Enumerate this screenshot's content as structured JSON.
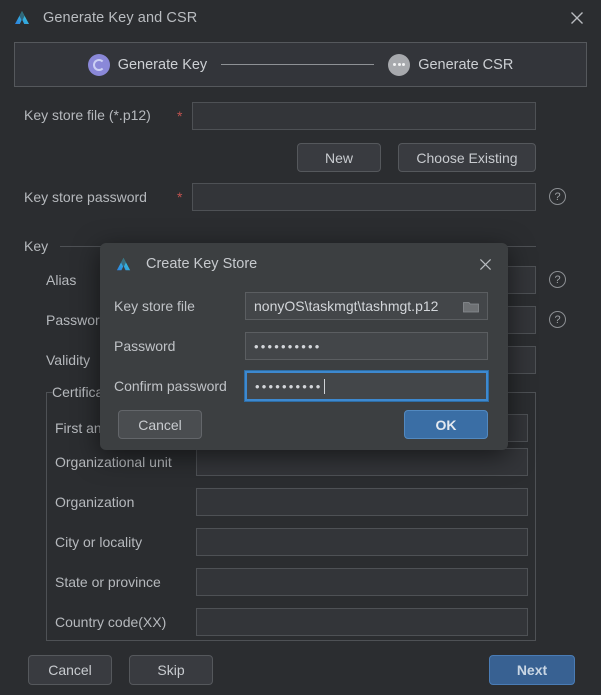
{
  "window": {
    "title": "Generate Key and CSR",
    "logo_icon": "android-studio-logo-icon",
    "close_icon": "close-icon"
  },
  "stepper": {
    "steps": [
      {
        "label": "Generate Key",
        "state": "active",
        "icon": "spinner-circle-icon"
      },
      {
        "label": "Generate CSR",
        "state": "pending",
        "icon": "ellipsis-circle-icon"
      }
    ]
  },
  "form": {
    "keystore_file": {
      "label": "Key store file (*.p12)",
      "required_marker": "*",
      "value": "",
      "placeholder": ""
    },
    "buttons": {
      "new": "New",
      "choose_existing": "Choose Existing"
    },
    "keystore_password": {
      "label": "Key store password",
      "required_marker": "*",
      "value": "",
      "placeholder": ""
    },
    "key_group": {
      "title": "Key",
      "fields": [
        {
          "label": "Alias",
          "value": ""
        },
        {
          "label": "Password",
          "value": ""
        },
        {
          "label": "Validity",
          "value": ""
        }
      ]
    },
    "certificate_group": {
      "title": "Certificate",
      "fields": [
        {
          "label": "First and last name",
          "value": ""
        },
        {
          "label": "Organizational unit",
          "value": ""
        },
        {
          "label": "Organization",
          "value": ""
        },
        {
          "label": "City or locality",
          "value": ""
        },
        {
          "label": "State or province",
          "value": ""
        },
        {
          "label": "Country code(XX)",
          "value": ""
        }
      ]
    },
    "help_icon": "question-mark-icon"
  },
  "footer": {
    "cancel": "Cancel",
    "skip": "Skip",
    "next": "Next"
  },
  "modal": {
    "title": "Create Key Store",
    "logo_icon": "android-studio-logo-icon",
    "close_icon": "close-icon",
    "keystore_file": {
      "label": "Key store file",
      "value": "nonyOS\\taskmgt\\tashmgt.p12",
      "browse_icon": "folder-icon"
    },
    "password": {
      "label": "Password",
      "value": "••••••••••"
    },
    "confirm_password": {
      "label": "Confirm password",
      "value": "••••••••••",
      "focused": true
    },
    "cancel": "Cancel",
    "ok": "OK"
  },
  "colors": {
    "window_bg": "#2b2d30",
    "modal_bg": "#3c3f41",
    "accent_blue": "#3d89d0",
    "primary_button": "#386192",
    "required_red": "#c0524f",
    "step_active": "#8a88d8"
  }
}
